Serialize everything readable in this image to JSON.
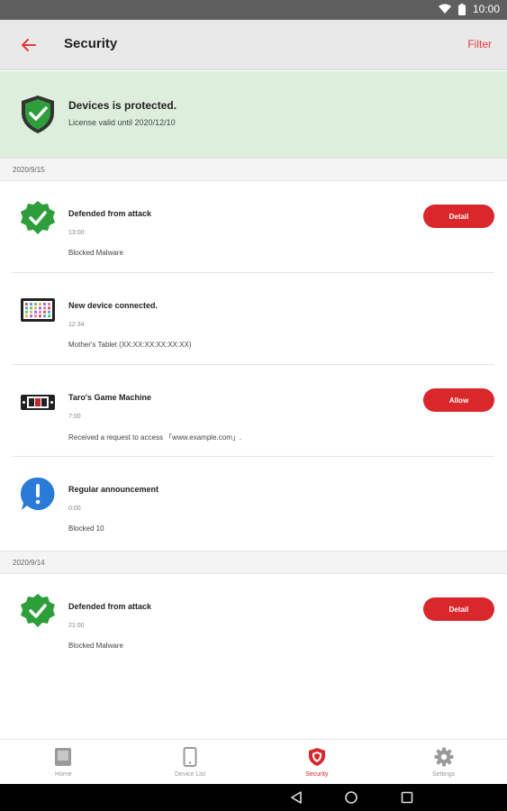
{
  "statusbar": {
    "time": "10:00"
  },
  "appbar": {
    "title": "Security",
    "filter_label": "Filter"
  },
  "banner": {
    "title": "Devices is protected.",
    "subtitle": "License valid until 2020/12/10"
  },
  "groups": [
    {
      "date": "2020/9/15",
      "items": [
        {
          "icon": "check-badge-icon",
          "title": "Defended from attack",
          "time": "13:00",
          "description": "Blocked Malware",
          "action": "Detail"
        },
        {
          "icon": "tablet-icon",
          "title": "New device connected.",
          "time": "12:34",
          "description": "Mother's Tablet (XX:XX:XX:XX:XX:XX)",
          "action": ""
        },
        {
          "icon": "game-machine-icon",
          "title": "Taro's Game Machine",
          "time": "7:00",
          "description": "Received a request to access 「www.example.com」.",
          "action": "Allow"
        },
        {
          "icon": "announcement-icon",
          "title": "Regular announcement",
          "time": "0:00",
          "description": "Blocked 10",
          "action": ""
        }
      ]
    },
    {
      "date": "2020/9/14",
      "items": [
        {
          "icon": "check-badge-icon",
          "title": "Defended from attack",
          "time": "21:00",
          "description": "Blocked Malware",
          "action": "Detail"
        }
      ]
    }
  ],
  "bottomnav": {
    "tabs": [
      {
        "label": "Home",
        "icon": "home-icon"
      },
      {
        "label": "Device List",
        "icon": "device-list-icon"
      },
      {
        "label": "Security",
        "icon": "security-shield-icon",
        "active": true
      },
      {
        "label": "Settings",
        "icon": "settings-gear-icon"
      }
    ]
  },
  "colors": {
    "accent": "#d9272b",
    "banner_bg": "#ddeedd",
    "check_green": "#2e9e3b",
    "info_blue": "#2a7ad8"
  }
}
